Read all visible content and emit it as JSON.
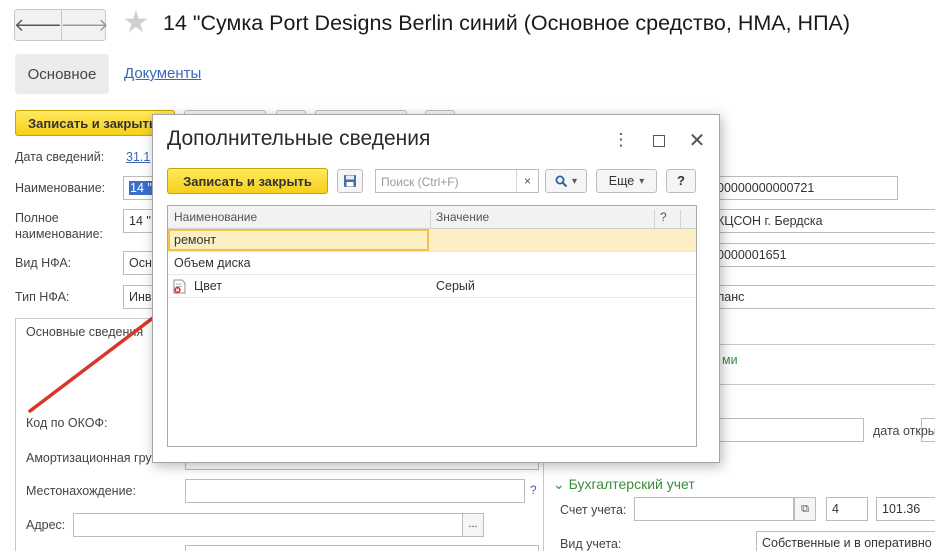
{
  "window": {
    "title": "14 \"Сумка Port Designs Berlin синий (Основное средство, НМА, НПА)",
    "nav_back": "🡐",
    "nav_forward": "🡒",
    "star_icon": "star-icon"
  },
  "tabs": {
    "main": "Основное",
    "documents": "Документы"
  },
  "toolbar": {
    "save_close": "Записать и закрыть"
  },
  "form": {
    "date_label": "Дата сведений:",
    "date_value": "31.1",
    "name_label": "Наименование:",
    "name_value": "14 \"",
    "fullname_label": "Полное наименование:",
    "fullname_value": "14 \"",
    "vid_label": "Вид НФА:",
    "vid_value": "Осн",
    "tip_label": "Тип НФА:",
    "tip_value": "Инв",
    "group_title": "Основные сведения",
    "okof_label": "Код по ОКОФ:",
    "amort_label": "Амортизационная гру",
    "location_label": "Местонахождение:",
    "address_label": "Адрес:",
    "q_mark": "?",
    "ellipsis": "..."
  },
  "right": {
    "inv_number": "00000000000721",
    "org": "КЦСОН г. Бердска",
    "num2": "0000001651",
    "balance": "ланс",
    "link_frag": "ми",
    "date_open_label": "дата откры",
    "accounting_title": "Бухгалтерский учет",
    "account_label": "Счет учета:",
    "account_code": "4",
    "account_value": "101.36",
    "type_label": "Вид учета:",
    "type_value": "Собственные и в оперативно"
  },
  "modal": {
    "title": "Дополнительные сведения",
    "save_close": "Записать и закрыть",
    "search_placeholder": "Поиск (Ctrl+F)",
    "search_clear": "×",
    "more": "Еще",
    "help": "?",
    "columns": [
      "Наименование",
      "Значение",
      "?"
    ],
    "rows": [
      {
        "name": "ремонт",
        "value": "",
        "selected": true
      },
      {
        "name": "Объем диска",
        "value": "",
        "selected": false
      },
      {
        "name": "Цвет",
        "value": "Серый",
        "selected": false,
        "icon": "required-property-icon"
      }
    ]
  },
  "colors": {
    "accent_yellow": "#f7cf1b",
    "link_blue": "#3a67b6",
    "arrow_red": "#d9362b",
    "section_green": "#3a8c3a"
  }
}
